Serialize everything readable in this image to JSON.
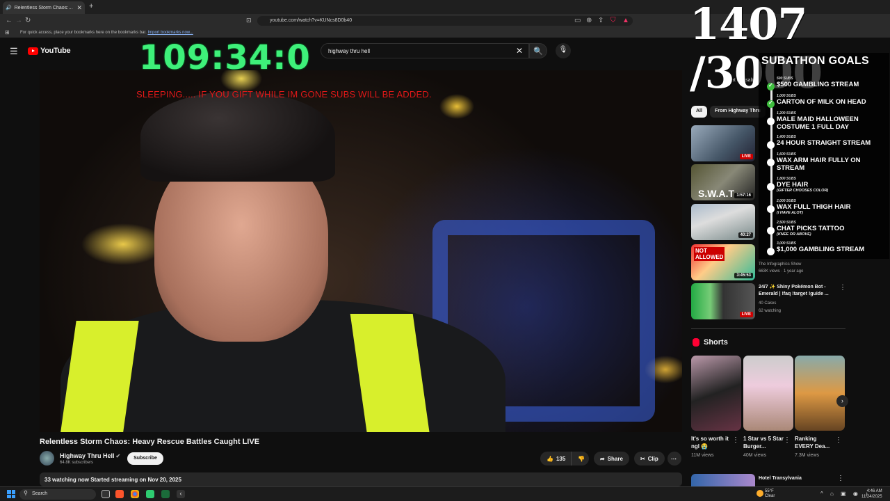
{
  "browser": {
    "tab_title": "Relentless Storm Chaos: Heav",
    "tab_close": "✕",
    "new_tab": "+",
    "url": "youtube.com/watch?v=KUNcs8D0b40",
    "bookmarks_prompt": "For quick access, place your bookmarks here on the bookmarks bar.",
    "bookmarks_link": "Import bookmarks now..."
  },
  "header": {
    "logo_text": "YouTube",
    "search_value": "highway thru hell",
    "search_clear": "✕"
  },
  "overlay": {
    "timer": "109:34:0",
    "sub_counter": "1407 /3000",
    "sleep_message": "SLEEPING.....  IF YOU GIFT WHILE IM GONE SUBS WILL BE ADDED."
  },
  "video": {
    "title": "Relentless Storm Chaos: Heavy Rescue Battles Caught LIVE",
    "channel": "Highway Thru Hell",
    "subscribers": "64.8K subscribers",
    "subscribe_label": "Subscribe",
    "likes": "135",
    "share_label": "Share",
    "clip_label": "Clip",
    "description_meta": "33 watching now  Started streaming on Nov 20, 2025"
  },
  "sidebar": {
    "chat_status": "Chat is disabl",
    "chips": [
      "All",
      "From Highway Thru"
    ],
    "recommendations": [
      {
        "badge": "LIVE",
        "live": true,
        "title": "",
        "meta": []
      },
      {
        "badge": "1:57:16",
        "live": false,
        "title": "",
        "meta": []
      },
      {
        "badge": "40:27",
        "live": false,
        "title": "",
        "meta": []
      },
      {
        "badge": "3:45:53",
        "live": false,
        "title": "",
        "meta": [
          "The Infographics Show",
          "663K views · 1 year ago"
        ]
      },
      {
        "badge": "LIVE",
        "live": true,
        "title": "24/7 ✨ Shiny Pokémon Bot - Emerald | !faq !target !guide ...",
        "meta": [
          "40 Cakes",
          "62 watching"
        ]
      }
    ],
    "shorts_heading": "Shorts",
    "shorts": [
      {
        "title": "It's so worth it ngl 😭",
        "views": "11M views"
      },
      {
        "title": "1 Star vs 5 Star Burger...",
        "views": "40M views"
      },
      {
        "title": "Ranking EVERY Dea...",
        "views": "7.3M views"
      }
    ],
    "bottom_rec_title": "Hotel Transylvania"
  },
  "goals": {
    "title": "SUBATHON GOALS",
    "items": [
      {
        "subs": "500 SUBS",
        "label": "$500 GAMBLING STREAM",
        "done": true,
        "note": ""
      },
      {
        "subs": "1,000 SUBS",
        "label": "CARTON OF MILK ON HEAD",
        "done": true,
        "note": ""
      },
      {
        "subs": "1,200 SUBS",
        "label": "MALE MAID HALLOWEEN COSTUME 1 FULL DAY",
        "done": false,
        "note": ""
      },
      {
        "subs": "1,400 SUBS",
        "label": "24 HOUR STRAIGHT STREAM",
        "done": false,
        "note": ""
      },
      {
        "subs": "1,600 SUBS",
        "label": "WAX ARM HAIR FULLY ON STREAM",
        "done": false,
        "note": ""
      },
      {
        "subs": "1,800 SUBS",
        "label": "DYE HAIR",
        "done": false,
        "note": "(GIFTER CHOOSES COLOR)"
      },
      {
        "subs": "2,000 SUBS",
        "label": "WAX FULL THIGH HAIR",
        "done": false,
        "note": "(I HAVE ALOT)"
      },
      {
        "subs": "2,500 SUBS",
        "label": "CHAT PICKS TATTOO",
        "done": false,
        "note": "(KNEE OR ABOVE)"
      },
      {
        "subs": "3,000 SUBS",
        "label": "$1,000 GAMBLING STREAM",
        "done": false,
        "note": ""
      }
    ]
  },
  "taskbar": {
    "search_placeholder": "Search",
    "temperature": "55°F",
    "weather_condition": "Clear",
    "time": "4:46 AM",
    "date": "11/24/2025"
  },
  "colors": {
    "timer_green": "#3ef07a",
    "sleep_red": "#e01818",
    "youtube_red": "#ff0000",
    "live_red": "#cc0000"
  }
}
